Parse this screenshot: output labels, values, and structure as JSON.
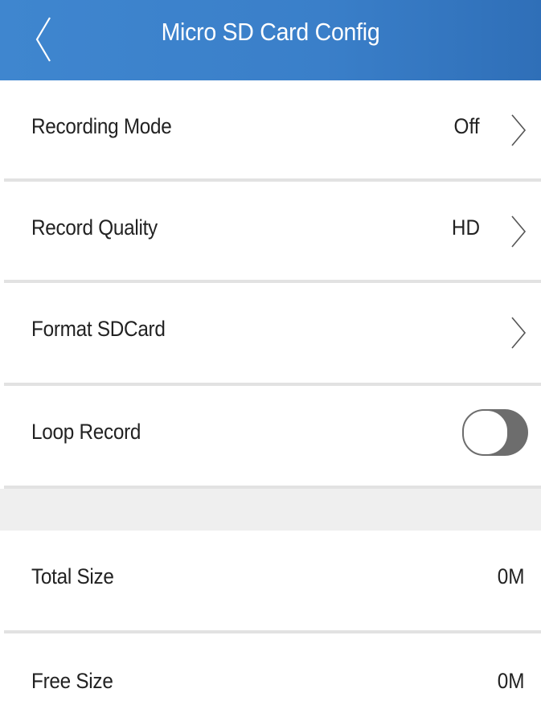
{
  "header": {
    "title": "Micro SD Card Config",
    "back_icon": "chevron-left-icon"
  },
  "settings": {
    "recording_mode": {
      "label": "Recording Mode",
      "value": "Off"
    },
    "record_quality": {
      "label": "Record Quality",
      "value": "HD"
    },
    "format_sdcard": {
      "label": "Format SDCard"
    },
    "loop_record": {
      "label": "Loop Record",
      "enabled": false
    }
  },
  "storage": {
    "total_size": {
      "label": "Total Size",
      "value": "0M"
    },
    "free_size": {
      "label": "Free Size",
      "value": "0M"
    }
  },
  "colors": {
    "accent": "#3a7fc9",
    "toggle_off": "#6d6d6d",
    "divider": "#e2e2e2",
    "section_bg": "#efefef"
  }
}
